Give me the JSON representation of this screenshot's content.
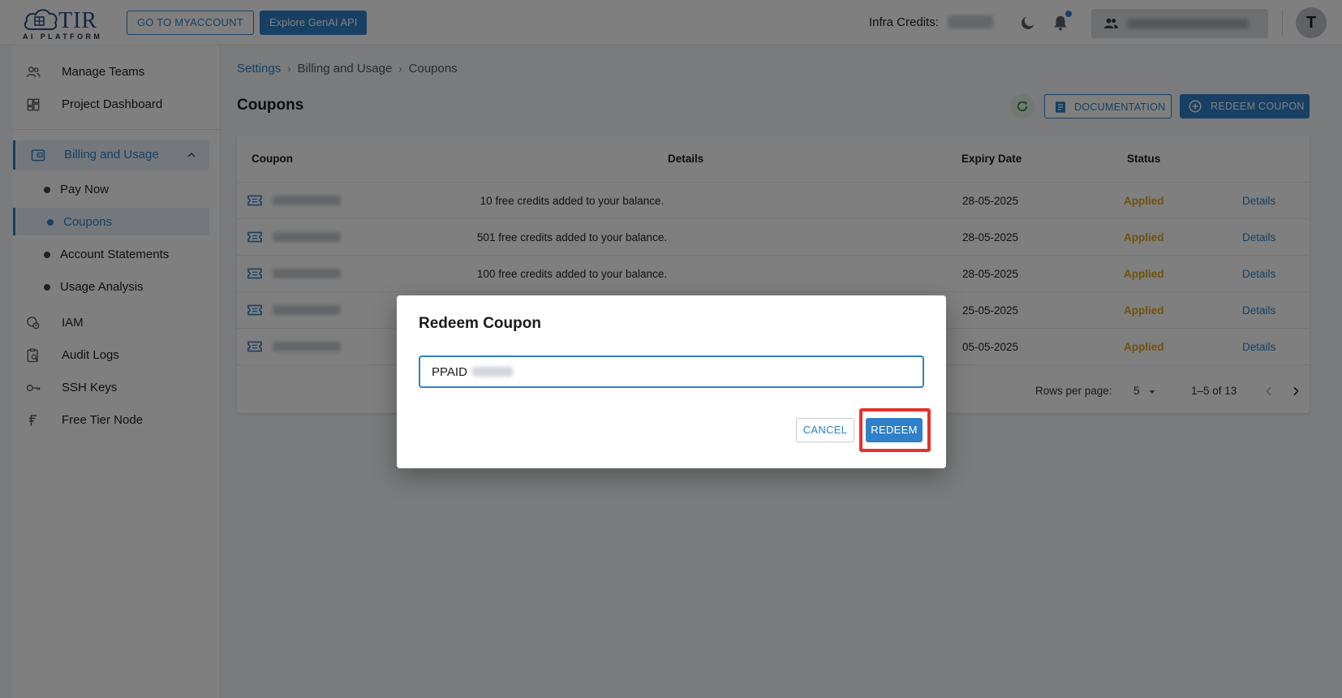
{
  "topbar": {
    "logo_name": "TIR",
    "logo_sub": "AI PLATFORM",
    "myaccount_label": "GO TO MYACCOUNT",
    "genai_label": "Explore GenAI API",
    "credits_label": "Infra Credits:",
    "avatar_initial": "T"
  },
  "sidebar": {
    "items": [
      {
        "label": "Manage Teams",
        "icon": "users-icon"
      },
      {
        "label": "Project Dashboard",
        "icon": "dashboard-icon"
      }
    ],
    "billing": {
      "label": "Billing and Usage",
      "icon": "wallet-icon",
      "sub_items": [
        {
          "label": "Pay Now"
        },
        {
          "label": "Coupons"
        },
        {
          "label": "Account Statements"
        },
        {
          "label": "Usage Analysis"
        }
      ]
    },
    "lower_items": [
      {
        "label": "IAM",
        "icon": "iam-icon"
      },
      {
        "label": "Audit Logs",
        "icon": "audit-logs-icon"
      },
      {
        "label": "SSH Keys",
        "icon": "key-icon"
      },
      {
        "label": "Free Tier Node",
        "icon": "free-tier-icon"
      }
    ]
  },
  "main": {
    "breadcrumb": [
      "Settings",
      "Billing and Usage",
      "Coupons"
    ],
    "title": "Coupons",
    "documentation_label": "DOCUMENTATION",
    "redeem_coupon_label": "REDEEM COUPON",
    "table": {
      "headers": [
        "Coupon",
        "Details",
        "Expiry Date",
        "Status"
      ],
      "rows": [
        {
          "details": "10 free credits added to your balance.",
          "expiry": "28-05-2025",
          "status": "Applied",
          "action": "Details"
        },
        {
          "details": "501 free credits added to your balance.",
          "expiry": "28-05-2025",
          "status": "Applied",
          "action": "Details"
        },
        {
          "details": "100 free credits added to your balance.",
          "expiry": "28-05-2025",
          "status": "Applied",
          "action": "Details"
        },
        {
          "details": "",
          "expiry": "25-05-2025",
          "status": "Applied",
          "action": "Details"
        },
        {
          "details": "",
          "expiry": "05-05-2025",
          "status": "Applied",
          "action": "Details"
        }
      ],
      "rows_per_page_label": "Rows per page:",
      "rows_per_page_value": "5",
      "range": "1–5 of 13"
    }
  },
  "dialog": {
    "title": "Redeem Coupon",
    "input_value": "PPAID",
    "cancel_label": "CANCEL",
    "redeem_label": "REDEEM"
  },
  "colors": {
    "accent": "#2f80c9",
    "status_applied": "#e3a21a",
    "highlight": "#e5312b"
  }
}
